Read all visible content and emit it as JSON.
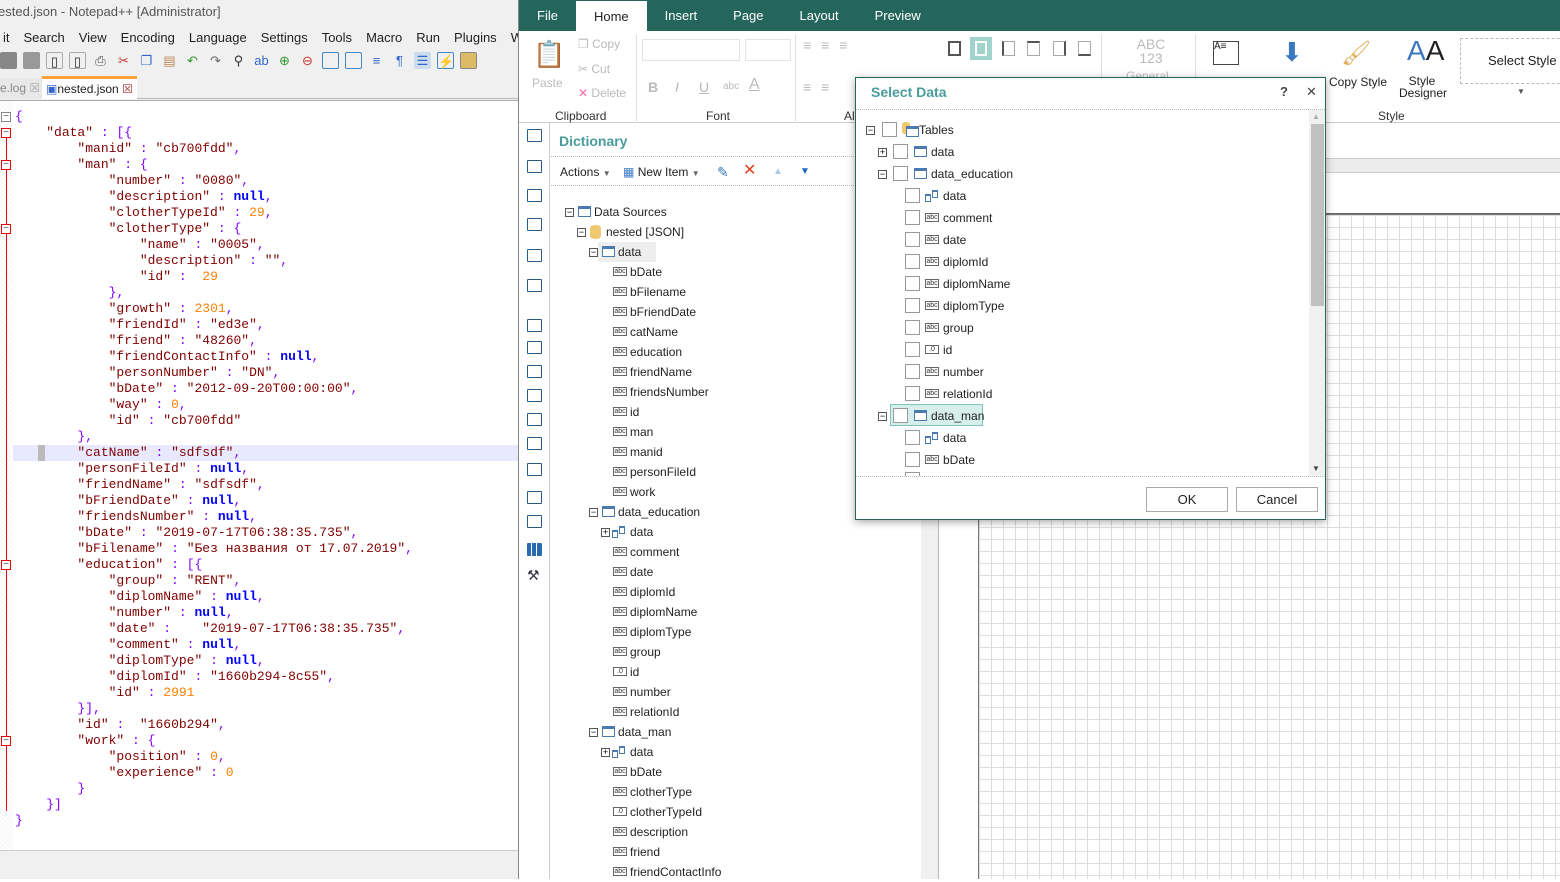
{
  "notepad": {
    "title": "ested.json - Notepad++ [Administrator]",
    "menu": [
      "it",
      "Search",
      "View",
      "Encoding",
      "Language",
      "Settings",
      "Tools",
      "Macro",
      "Run",
      "Plugins",
      "Window"
    ],
    "tabs": [
      {
        "label": "e.log",
        "active": false
      },
      {
        "label": "nested.json",
        "active": true
      }
    ],
    "highlighted_line": 21,
    "fold_lines": [
      0,
      1,
      3,
      7,
      28,
      39
    ],
    "lines": [
      "{",
      "    \"data\" : [{",
      "        \"manid\" : \"cb700fdd\",",
      "        \"man\" : {",
      "            \"number\" : \"0080\",",
      "            \"description\" : null,",
      "            \"clotherTypeId\" : 29,",
      "            \"clotherType\" : {",
      "                \"name\" : \"0005\",",
      "                \"description\" : \"\",",
      "                \"id\" :  29",
      "            },",
      "            \"growth\" : 2301,",
      "            \"friendId\" : \"ed3e\",",
      "            \"friend\" : \"48260\",",
      "            \"friendContactInfo\" : null,",
      "            \"personNumber\" : \"DN\",",
      "            \"bDate\" : \"2012-09-20T00:00:00\",",
      "            \"way\" : 0,",
      "            \"id\" : \"cb700fdd\"",
      "        },",
      "        \"catName\" : \"sdfsdf\",",
      "        \"personFileId\" : null,",
      "        \"friendName\" : \"sdfsdf\",",
      "        \"bFriendDate\" : null,",
      "        \"friendsNumber\" : null,",
      "        \"bDate\" : \"2019-07-17T06:38:35.735\",",
      "        \"bFilename\" : \"Без названия от 17.07.2019\",",
      "        \"education\" : [{",
      "            \"group\" : \"RENT\",",
      "            \"diplomName\" : null,",
      "            \"number\" : null,",
      "            \"date\" :    \"2019-07-17T06:38:35.735\",",
      "            \"comment\" : null,",
      "            \"diplomType\" : null,",
      "            \"diplomId\" : \"1660b294-8c55\",",
      "            \"id\" : 2991",
      "        }],",
      "        \"id\" :  \"1660b294\",",
      "        \"work\" : {",
      "            \"position\" : 0,",
      "            \"experience\" : 0",
      "        }",
      "    }]",
      "}"
    ]
  },
  "designer": {
    "tabs": [
      "File",
      "Home",
      "Insert",
      "Page",
      "Layout",
      "Preview"
    ],
    "active_tab": "Home",
    "accent": "#24655c",
    "ribbon": {
      "paste": "Paste",
      "copy": "Copy",
      "cut": "Cut",
      "delete": "Delete",
      "clipboard": "Clipboard",
      "font": "Font",
      "align": "Al",
      "general_icon": "ABC 123",
      "general": "General",
      "copy_style": "Copy Style",
      "style_designer": "Style Designer",
      "select_style": "Select Style",
      "style": "Style",
      "bold": "B",
      "italic": "I",
      "underline": "U",
      "strike": "abc"
    },
    "dictionary": {
      "title": "Dictionary",
      "actions": "Actions",
      "new_item": "New Item",
      "tree": [
        {
          "label": "Data Sources",
          "level": 0,
          "exp": "-",
          "icon": "table"
        },
        {
          "label": "nested [JSON]",
          "level": 1,
          "exp": "-",
          "icon": "db"
        },
        {
          "label": "data",
          "level": 2,
          "exp": "-",
          "icon": "table",
          "selected": true
        },
        {
          "label": "bDate",
          "level": 3,
          "icon": "abc"
        },
        {
          "label": "bFilename",
          "level": 3,
          "icon": "abc"
        },
        {
          "label": "bFriendDate",
          "level": 3,
          "icon": "abc"
        },
        {
          "label": "catName",
          "level": 3,
          "icon": "abc"
        },
        {
          "label": "education",
          "level": 3,
          "icon": "abc"
        },
        {
          "label": "friendName",
          "level": 3,
          "icon": "abc"
        },
        {
          "label": "friendsNumber",
          "level": 3,
          "icon": "abc"
        },
        {
          "label": "id",
          "level": 3,
          "icon": "abc"
        },
        {
          "label": "man",
          "level": 3,
          "icon": "abc"
        },
        {
          "label": "manid",
          "level": 3,
          "icon": "abc"
        },
        {
          "label": "personFileId",
          "level": 3,
          "icon": "abc"
        },
        {
          "label": "work",
          "level": 3,
          "icon": "abc"
        },
        {
          "label": "data_education",
          "level": 2,
          "exp": "-",
          "icon": "table"
        },
        {
          "label": "data",
          "level": 3,
          "exp": "+",
          "icon": "relation"
        },
        {
          "label": "comment",
          "level": 3,
          "icon": "abc"
        },
        {
          "label": "date",
          "level": 3,
          "icon": "abc"
        },
        {
          "label": "diplomId",
          "level": 3,
          "icon": "abc"
        },
        {
          "label": "diplomName",
          "level": 3,
          "icon": "abc"
        },
        {
          "label": "diplomType",
          "level": 3,
          "icon": "abc"
        },
        {
          "label": "group",
          "level": 3,
          "icon": "abc"
        },
        {
          "label": "id",
          "level": 3,
          "icon": "num"
        },
        {
          "label": "number",
          "level": 3,
          "icon": "abc"
        },
        {
          "label": "relationId",
          "level": 3,
          "icon": "abc"
        },
        {
          "label": "data_man",
          "level": 2,
          "exp": "-",
          "icon": "table"
        },
        {
          "label": "data",
          "level": 3,
          "exp": "+",
          "icon": "relation"
        },
        {
          "label": "bDate",
          "level": 3,
          "icon": "abc"
        },
        {
          "label": "clotherType",
          "level": 3,
          "icon": "abc"
        },
        {
          "label": "clotherTypeId",
          "level": 3,
          "icon": "num"
        },
        {
          "label": "description",
          "level": 3,
          "icon": "abc"
        },
        {
          "label": "friend",
          "level": 3,
          "icon": "abc"
        },
        {
          "label": "friendContactInfo",
          "level": 3,
          "icon": "abc"
        }
      ]
    },
    "select_data": {
      "title": "Select Data",
      "help": "?",
      "close": "✕",
      "tree": [
        {
          "label": "Tables",
          "level": 0,
          "exp": "-",
          "icon": "tables",
          "checked": false
        },
        {
          "label": "data",
          "level": 1,
          "exp": "+",
          "icon": "table",
          "checked": false
        },
        {
          "label": "data_education",
          "level": 1,
          "exp": "-",
          "icon": "table",
          "checked": false
        },
        {
          "label": "data",
          "level": 2,
          "icon": "relation",
          "checked": false
        },
        {
          "label": "comment",
          "level": 2,
          "icon": "abc",
          "checked": false
        },
        {
          "label": "date",
          "level": 2,
          "icon": "abc",
          "checked": false
        },
        {
          "label": "diplomId",
          "level": 2,
          "icon": "abc",
          "checked": false
        },
        {
          "label": "diplomName",
          "level": 2,
          "icon": "abc",
          "checked": false
        },
        {
          "label": "diplomType",
          "level": 2,
          "icon": "abc",
          "checked": false
        },
        {
          "label": "group",
          "level": 2,
          "icon": "abc",
          "checked": false
        },
        {
          "label": "id",
          "level": 2,
          "icon": "num",
          "checked": false
        },
        {
          "label": "number",
          "level": 2,
          "icon": "abc",
          "checked": false
        },
        {
          "label": "relationId",
          "level": 2,
          "icon": "abc",
          "checked": false
        },
        {
          "label": "data_man",
          "level": 1,
          "exp": "-",
          "icon": "table",
          "checked": false,
          "selected": true
        },
        {
          "label": "data",
          "level": 2,
          "icon": "relation",
          "checked": false
        },
        {
          "label": "bDate",
          "level": 2,
          "icon": "abc",
          "checked": false
        }
      ],
      "ok": "OK",
      "cancel": "Cancel"
    }
  }
}
